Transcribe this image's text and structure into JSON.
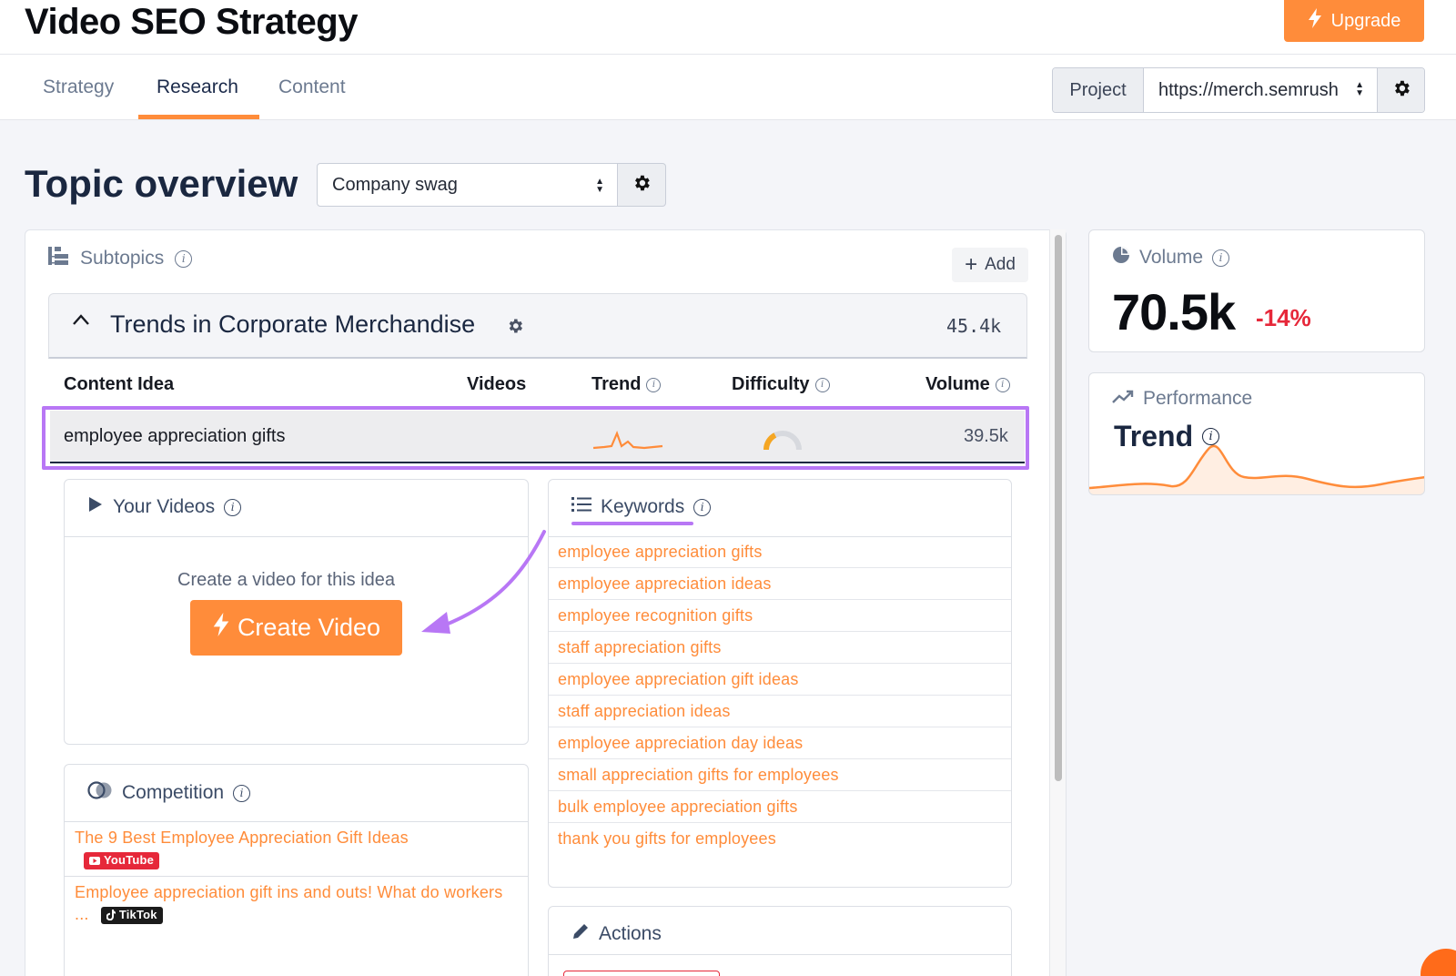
{
  "header": {
    "app_title": "Video SEO Strategy",
    "upgrade_label": "Upgrade"
  },
  "nav": {
    "tabs": [
      {
        "label": "Strategy",
        "active": false
      },
      {
        "label": "Research",
        "active": true
      },
      {
        "label": "Content",
        "active": false
      }
    ],
    "project_label": "Project",
    "project_value": "https://merch.semrush",
    "accent_color": "#ff8c3a"
  },
  "topic": {
    "title": "Topic overview",
    "selected": "Company swag"
  },
  "subtopics": {
    "label": "Subtopics",
    "add_label": "Add",
    "card": {
      "title": "Trends in Corporate Merchandise",
      "volume": "45.4k"
    },
    "columns": [
      "Content Idea",
      "Videos",
      "Trend",
      "Difficulty",
      "Volume"
    ],
    "row": {
      "idea": "employee appreciation gifts",
      "volume": "39.5k",
      "difficulty_level": 0.35
    }
  },
  "your_videos": {
    "title": "Your Videos",
    "caption": "Create a video for this idea",
    "button": "Create Video"
  },
  "keywords": {
    "title": "Keywords",
    "items": [
      "employee appreciation gifts",
      "employee appreciation ideas",
      "employee recognition gifts",
      "staff appreciation gifts",
      "employee appreciation gift ideas",
      "staff appreciation ideas",
      "employee appreciation day ideas",
      "small appreciation gifts for employees",
      "bulk employee appreciation gifts",
      "thank you gifts for employees"
    ]
  },
  "competition": {
    "title": "Competition",
    "items": [
      {
        "title": "The 9 Best Employee Appreciation Gift Ideas",
        "source": "YouTube"
      },
      {
        "title": "Employee appreciation gift ins and outs! What do workers ...",
        "source": "TikTok"
      }
    ]
  },
  "actions": {
    "title": "Actions"
  },
  "volume_card": {
    "label": "Volume",
    "value": "70.5k",
    "change": "-14%"
  },
  "performance_card": {
    "label": "Performance",
    "title": "Trend"
  }
}
